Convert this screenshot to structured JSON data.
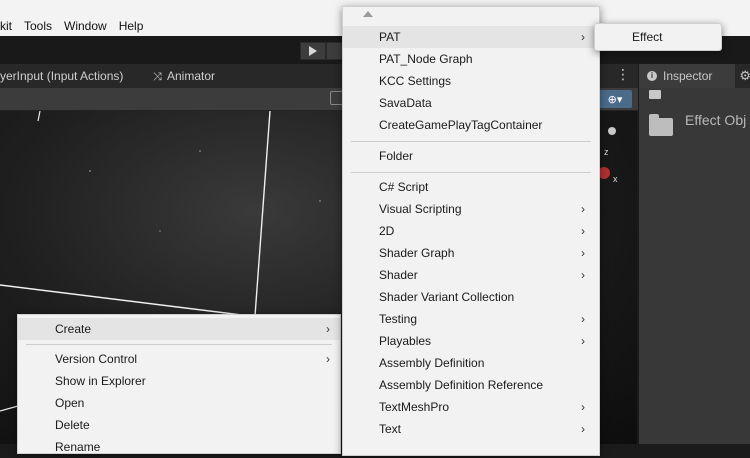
{
  "menubar": {
    "items": [
      "kit",
      "Tools",
      "Window",
      "Help"
    ]
  },
  "tabs": {
    "input_actions": "yerInput (Input Actions)",
    "animator": "Animator"
  },
  "inspector": {
    "tab_label": "Inspector",
    "object_title": "Effect Obj"
  },
  "context_menu": {
    "create": "Create",
    "version_control": "Version Control",
    "show_in_explorer": "Show in Explorer",
    "open": "Open",
    "delete": "Delete",
    "rename": "Rename"
  },
  "create_menu": {
    "items": [
      {
        "label": "PAT",
        "submenu": true
      },
      {
        "label": "PAT_Node Graph",
        "submenu": false
      },
      {
        "label": "KCC Settings",
        "submenu": false
      },
      {
        "label": "SavaData",
        "submenu": false
      },
      {
        "label": "CreateGamePlayTagContainer",
        "submenu": false
      },
      {
        "label": "Folder",
        "submenu": false
      },
      {
        "label": "C# Script",
        "submenu": false
      },
      {
        "label": "Visual Scripting",
        "submenu": true
      },
      {
        "label": "2D",
        "submenu": true
      },
      {
        "label": "Shader Graph",
        "submenu": true
      },
      {
        "label": "Shader",
        "submenu": true
      },
      {
        "label": "Shader Variant Collection",
        "submenu": false
      },
      {
        "label": "Testing",
        "submenu": true
      },
      {
        "label": "Playables",
        "submenu": true
      },
      {
        "label": "Assembly Definition",
        "submenu": false
      },
      {
        "label": "Assembly Definition Reference",
        "submenu": false
      },
      {
        "label": "TextMeshPro",
        "submenu": true
      },
      {
        "label": "Text",
        "submenu": true
      }
    ]
  },
  "pat_submenu": {
    "effect": "Effect"
  },
  "icons": {
    "play": "play-icon",
    "pause": "pause-icon",
    "search": "search-icon",
    "gizmo": "gizmo-icon",
    "gear": "gear-icon",
    "info": "info-icon",
    "folder": "folder-icon",
    "submenu_arrow": "chevron-right-icon"
  }
}
